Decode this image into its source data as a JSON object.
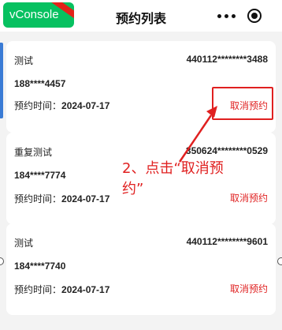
{
  "nav": {
    "title": "预约列表",
    "vconsole_label": "vConsole"
  },
  "date_label": "预约时间：",
  "cancel_label": "取消预约",
  "appointments": [
    {
      "name": "测试",
      "id_number": "440112********3488",
      "phone": "188****4457",
      "date": "2024-07-17"
    },
    {
      "name": "重复测试",
      "id_number": "350624********0529",
      "phone": "184****7774",
      "date": "2024-07-17"
    },
    {
      "name": "测试",
      "id_number": "440112********9601",
      "phone": "184****7740",
      "date": "2024-07-17"
    }
  ],
  "annotation": {
    "line1": "2、点击“取消预",
    "line2": "约”"
  },
  "colors": {
    "accent": "#e02424",
    "vconsole": "#07c160"
  },
  "icons": [
    "more-icon",
    "close-capsule-icon",
    "arrow-icon"
  ]
}
